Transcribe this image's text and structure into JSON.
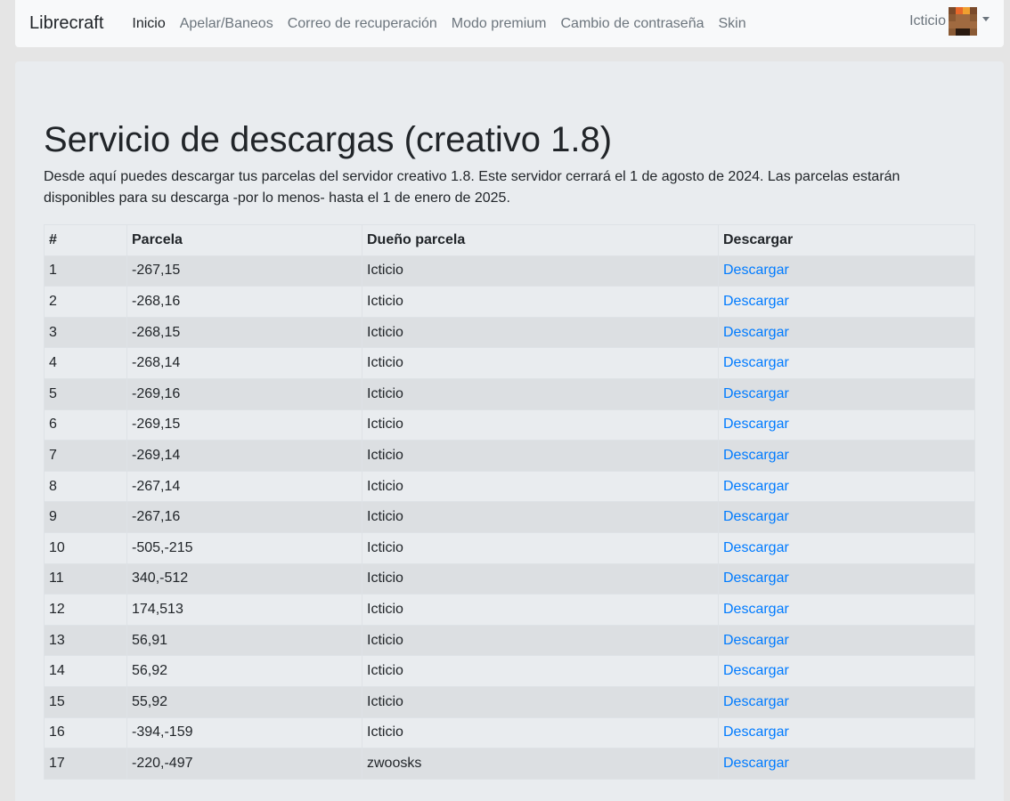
{
  "nav": {
    "brand": "Librecraft",
    "links": [
      {
        "label": "Inicio",
        "active": true
      },
      {
        "label": "Apelar/Baneos",
        "active": false
      },
      {
        "label": "Correo de recuperación",
        "active": false
      },
      {
        "label": "Modo premium",
        "active": false
      },
      {
        "label": "Cambio de contraseña",
        "active": false
      },
      {
        "label": "Skin",
        "active": false
      }
    ],
    "user": {
      "name": "Icticio",
      "avatar_icon": "minecraft-skin-head-icon"
    }
  },
  "colors": {
    "link": "#007bff",
    "navbar_bg": "#f8f9fa",
    "jumbotron_bg": "#e9ecef",
    "stripe": "#dcdfe2"
  },
  "main": {
    "title": "Servicio de descargas (creativo 1.8)",
    "intro": "Desde aquí puedes descargar tus parcelas del servidor creativo 1.8. Este servidor cerrará el 1 de agosto de 2024. Las parcelas estarán disponibles para su descarga -por lo menos- hasta el 1 de enero de 2025.",
    "table": {
      "headers": [
        "#",
        "Parcela",
        "Dueño parcela",
        "Descargar"
      ],
      "rows": [
        {
          "num": "1",
          "parcel": "-267,15",
          "owner": "Icticio",
          "action": "Descargar"
        },
        {
          "num": "2",
          "parcel": "-268,16",
          "owner": "Icticio",
          "action": "Descargar"
        },
        {
          "num": "3",
          "parcel": "-268,15",
          "owner": "Icticio",
          "action": "Descargar"
        },
        {
          "num": "4",
          "parcel": "-268,14",
          "owner": "Icticio",
          "action": "Descargar"
        },
        {
          "num": "5",
          "parcel": "-269,16",
          "owner": "Icticio",
          "action": "Descargar"
        },
        {
          "num": "6",
          "parcel": "-269,15",
          "owner": "Icticio",
          "action": "Descargar"
        },
        {
          "num": "7",
          "parcel": "-269,14",
          "owner": "Icticio",
          "action": "Descargar"
        },
        {
          "num": "8",
          "parcel": "-267,14",
          "owner": "Icticio",
          "action": "Descargar"
        },
        {
          "num": "9",
          "parcel": "-267,16",
          "owner": "Icticio",
          "action": "Descargar"
        },
        {
          "num": "10",
          "parcel": "-505,-215",
          "owner": "Icticio",
          "action": "Descargar"
        },
        {
          "num": "11",
          "parcel": "340,-512",
          "owner": "Icticio",
          "action": "Descargar"
        },
        {
          "num": "12",
          "parcel": "174,513",
          "owner": "Icticio",
          "action": "Descargar"
        },
        {
          "num": "13",
          "parcel": "56,91",
          "owner": "Icticio",
          "action": "Descargar"
        },
        {
          "num": "14",
          "parcel": "56,92",
          "owner": "Icticio",
          "action": "Descargar"
        },
        {
          "num": "15",
          "parcel": "55,92",
          "owner": "Icticio",
          "action": "Descargar"
        },
        {
          "num": "16",
          "parcel": "-394,-159",
          "owner": "Icticio",
          "action": "Descargar"
        },
        {
          "num": "17",
          "parcel": "-220,-497",
          "owner": "zwoosks",
          "action": "Descargar"
        }
      ]
    }
  }
}
